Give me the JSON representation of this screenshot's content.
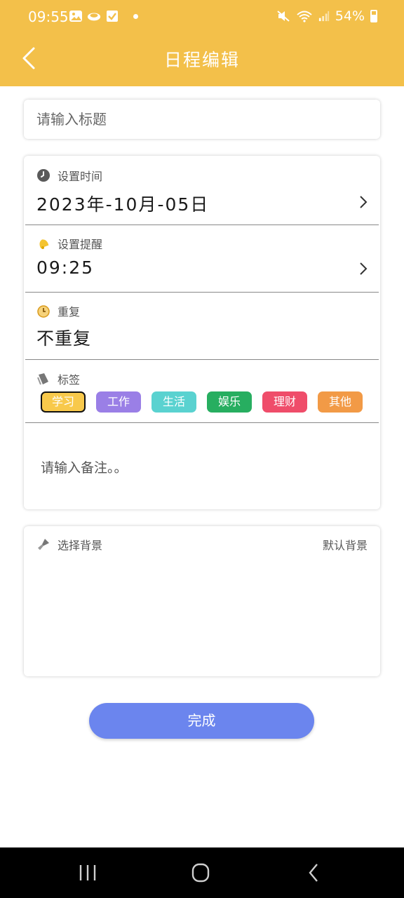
{
  "status_bar": {
    "time": "09:55",
    "battery": "54%",
    "left_icons": [
      "image-icon",
      "cloud-icon",
      "checkbox-icon"
    ],
    "right_icons": [
      "mute-icon",
      "wifi-icon",
      "signal-icon",
      "battery-icon"
    ]
  },
  "app_bar": {
    "title": "日程编辑",
    "back_icon": "back-arrow-icon"
  },
  "title_field": {
    "placeholder": "请输入标题",
    "value": ""
  },
  "time_row": {
    "label": "设置时间",
    "value": "2023年-10月-05日",
    "icon": "clock-icon"
  },
  "reminder_row": {
    "label": "设置提醒",
    "value": "09:25",
    "icon": "bell-icon"
  },
  "repeat_row": {
    "label": "重复",
    "value": "不重复",
    "icon": "alarm-clock-icon"
  },
  "tags_row": {
    "label": "标签",
    "icon": "tag-icon",
    "selected": "学习",
    "items": [
      {
        "label": "学习",
        "color": "#f8c94b"
      },
      {
        "label": "工作",
        "color": "#9a7fe6"
      },
      {
        "label": "生活",
        "color": "#5ad2d0"
      },
      {
        "label": "娱乐",
        "color": "#27ae60"
      },
      {
        "label": "理财",
        "color": "#ef4d6a"
      },
      {
        "label": "其他",
        "color": "#f29a46"
      }
    ]
  },
  "notes": {
    "placeholder": "请输入备注。。"
  },
  "background": {
    "label": "选择背景",
    "default_label": "默认背景",
    "icon": "brush-icon"
  },
  "done_button": {
    "label": "完成"
  },
  "colors": {
    "header": "#f3c04a",
    "button": "#6b85ee",
    "nav_bar": "#000000"
  }
}
